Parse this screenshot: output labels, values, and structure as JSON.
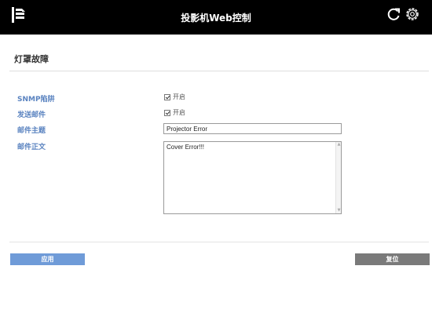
{
  "header": {
    "title": "投影机Web控制",
    "icons": {
      "menu": "menu-icon",
      "refresh": "refresh-icon",
      "settings": "gear-icon"
    }
  },
  "page": {
    "title": "灯罩故障"
  },
  "form": {
    "snmp_trap": {
      "label": "SNMP陷阱",
      "checkbox_label": "开启",
      "checked": true
    },
    "send_mail": {
      "label": "发送邮件",
      "checkbox_label": "开启",
      "checked": true
    },
    "mail_subject": {
      "label": "邮件主题",
      "value": "Projector Error"
    },
    "mail_body": {
      "label": "邮件正文",
      "value": "Cover Error!!!"
    }
  },
  "buttons": {
    "apply": "应用",
    "reset": "复位"
  },
  "colors": {
    "header_bg": "#000000",
    "label_blue": "#5a83c0",
    "apply_bg": "#6f9bd8",
    "reset_bg": "#7a7a7a"
  }
}
